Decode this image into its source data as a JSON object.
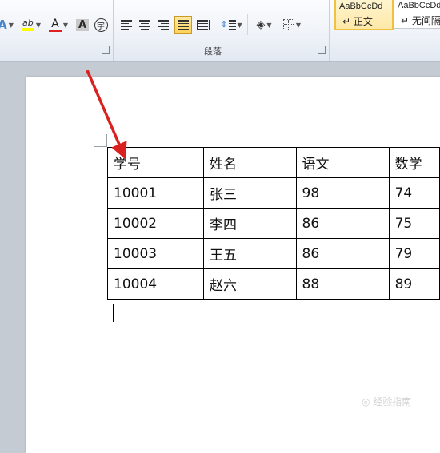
{
  "ribbon": {
    "font_group": {
      "text_effects_icon": "A",
      "highlight_icon": "ab",
      "font_color_icon": "A",
      "char_shading_icon": "A",
      "enclose_char_icon": "字"
    },
    "paragraph_group": {
      "label": "段落"
    },
    "styles": {
      "style1_preview": "AaBbCcDd",
      "style1_name": "↵ 正文",
      "style2_preview": "AaBbCcDd",
      "style2_name": "↵ 无间隔"
    }
  },
  "table": {
    "rows": [
      [
        "学号",
        "姓名",
        "语文",
        "数学"
      ],
      [
        "10001",
        "张三",
        "98",
        "74"
      ],
      [
        "10002",
        "李四",
        "86",
        "75"
      ],
      [
        "10003",
        "王五",
        "86",
        "79"
      ],
      [
        "10004",
        "赵六",
        "88",
        "89"
      ]
    ]
  },
  "annotation": {
    "arrow_color": "#d9211f"
  },
  "colors": {
    "highlight": "#ffff00",
    "font_color": "#e02020",
    "style_active_border": "#f0c040"
  }
}
